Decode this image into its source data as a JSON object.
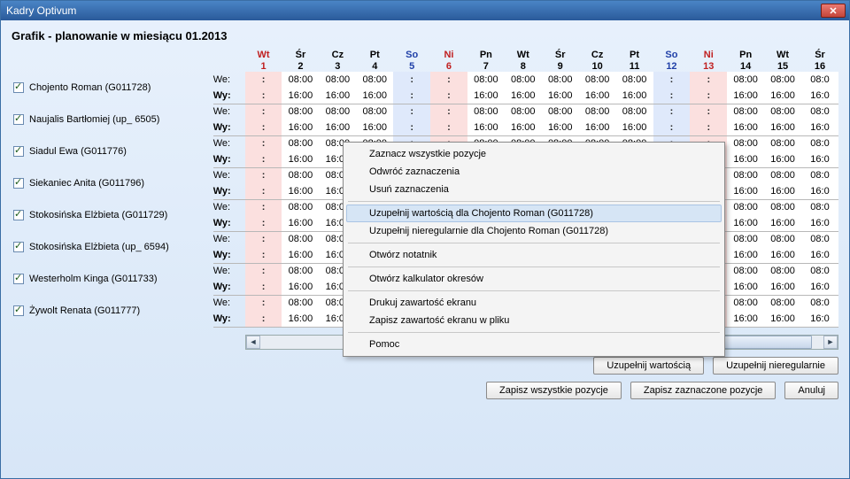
{
  "window": {
    "title": "Kadry Optivum"
  },
  "page_title": "Grafik - planowanie w miesiącu 01.2013",
  "row_labels": {
    "we": "We:",
    "wy": "Wy:"
  },
  "days": [
    {
      "dow": "Wt",
      "num": "1",
      "kind": "holiday"
    },
    {
      "dow": "Śr",
      "num": "2",
      "kind": "wk"
    },
    {
      "dow": "Cz",
      "num": "3",
      "kind": "wk"
    },
    {
      "dow": "Pt",
      "num": "4",
      "kind": "wk"
    },
    {
      "dow": "So",
      "num": "5",
      "kind": "weekend"
    },
    {
      "dow": "Ni",
      "num": "6",
      "kind": "holiday"
    },
    {
      "dow": "Pn",
      "num": "7",
      "kind": "wk"
    },
    {
      "dow": "Wt",
      "num": "8",
      "kind": "wk"
    },
    {
      "dow": "Śr",
      "num": "9",
      "kind": "wk"
    },
    {
      "dow": "Cz",
      "num": "10",
      "kind": "wk"
    },
    {
      "dow": "Pt",
      "num": "11",
      "kind": "wk"
    },
    {
      "dow": "So",
      "num": "12",
      "kind": "weekend"
    },
    {
      "dow": "Ni",
      "num": "13",
      "kind": "holiday"
    },
    {
      "dow": "Pn",
      "num": "14",
      "kind": "wk"
    },
    {
      "dow": "Wt",
      "num": "15",
      "kind": "wk"
    },
    {
      "dow": "Śr",
      "num": "16",
      "kind": "wk"
    }
  ],
  "employees": [
    {
      "name": "Chojento Roman (G011728)"
    },
    {
      "name": "Naujalis Bartłomiej (up_ 6505)"
    },
    {
      "name": "Siadul Ewa (G011776)"
    },
    {
      "name": "Siekaniec Anita (G011796)"
    },
    {
      "name": "Stokosińska Elżbieta (G011729)"
    },
    {
      "name": "Stokosińska Elżbieta (up_ 6594)"
    },
    {
      "name": "Westerholm Kinga (G011733)"
    },
    {
      "name": "Żywolt Renata (G011777)"
    }
  ],
  "time_we": "08:00",
  "time_wy": "16:00",
  "last_partial_we": "08:0",
  "last_partial_wy": "16:0",
  "context_menu": {
    "items": [
      {
        "label": "Zaznacz wszystkie pozycje",
        "sep_after": false
      },
      {
        "label": "Odwróć zaznaczenia",
        "sep_after": false
      },
      {
        "label": "Usuń zaznaczenia",
        "sep_after": true
      },
      {
        "label": "Uzupełnij wartością dla Chojento Roman (G011728)",
        "hl": true,
        "sep_after": false
      },
      {
        "label": "Uzupełnij nieregularnie dla Chojento Roman (G011728)",
        "sep_after": true
      },
      {
        "label": "Otwórz notatnik",
        "sep_after": true
      },
      {
        "label": "Otwórz kalkulator okresów",
        "sep_after": true
      },
      {
        "label": "Drukuj zawartość ekranu",
        "sep_after": false
      },
      {
        "label": "Zapisz zawartość ekranu w pliku",
        "sep_after": true
      },
      {
        "label": "Pomoc",
        "sep_after": false
      }
    ]
  },
  "buttons": {
    "fill_value": "Uzupełnij wartością",
    "fill_irregular": "Uzupełnij nieregularnie",
    "save_all": "Zapisz wszystkie pozycje",
    "save_selected": "Zapisz zaznaczone pozycje",
    "cancel": "Anuluj"
  }
}
